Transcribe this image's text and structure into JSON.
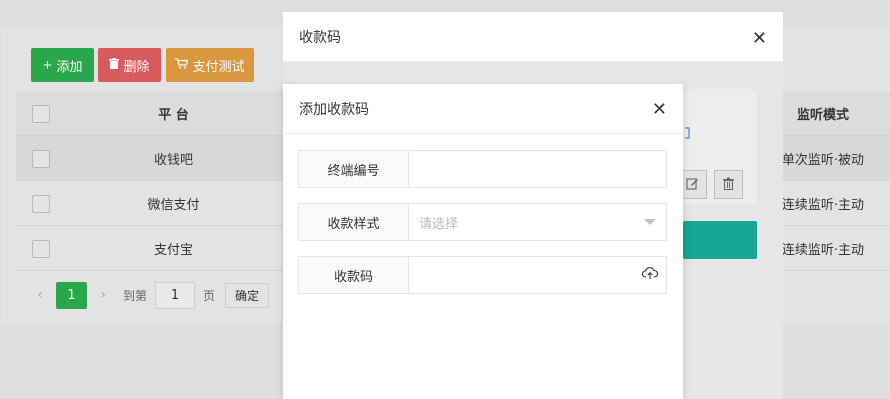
{
  "toolbar": {
    "add_label": "添加",
    "delete_label": "删除",
    "pay_test_label": "支付测试",
    "add_icon": "plus-icon",
    "delete_icon": "trash-icon",
    "pay_test_icon": "cart-icon"
  },
  "table": {
    "headers": {
      "platform": "平 台",
      "mode": "监听模式"
    },
    "rows": [
      {
        "platform": "收钱吧",
        "mode": "单次监听·被动"
      },
      {
        "platform": "微信支付",
        "mode": "连续监听·主动"
      },
      {
        "platform": "支付宝",
        "mode": "连续监听·主动"
      }
    ]
  },
  "pager": {
    "prev": "‹",
    "current": "1",
    "next": "›",
    "goto_label": "到第",
    "goto_value": "1",
    "page_unit": "页",
    "confirm_label": "确定"
  },
  "dialog_outer": {
    "title": "收款码",
    "close": "✕"
  },
  "dialog_inner": {
    "title": "添加收款码",
    "close": "✕",
    "fields": {
      "terminal_label": "终端编号",
      "terminal_value": "",
      "style_label": "收款样式",
      "style_placeholder": "请选择",
      "qrcode_label": "收款码",
      "qrcode_value": ""
    }
  },
  "colors": {
    "add": "#2aa64d",
    "delete": "#d95c5c",
    "pay_test": "#d9973e",
    "accent_teal": "#16a597",
    "link_blue": "#3a8ee6"
  }
}
